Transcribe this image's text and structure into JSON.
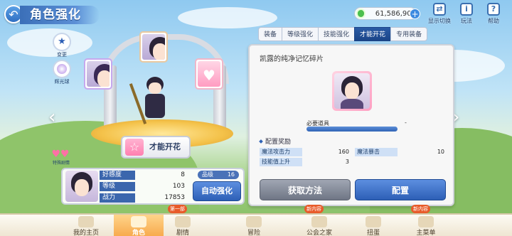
{
  "header": {
    "title": "角色强化",
    "money": "61,586,904",
    "icons": [
      {
        "icon": "display-switch-icon",
        "label": "显示切换"
      },
      {
        "icon": "howto-icon",
        "label": "玩法"
      },
      {
        "icon": "help-icon",
        "label": "帮助"
      }
    ]
  },
  "tabs": [
    {
      "label": "装备",
      "active": false
    },
    {
      "label": "等级强化",
      "active": false
    },
    {
      "label": "技能强化",
      "active": false
    },
    {
      "label": "才能开花",
      "active": true
    },
    {
      "label": "专用装备",
      "active": false
    }
  ],
  "panel": {
    "item_name": "凯露的纯净记忆碎片",
    "need_label": "必要道具",
    "need_count": "-",
    "need_progress": 1.0,
    "reward_title": "配置奖励",
    "stats": [
      {
        "name": "魔法攻击力",
        "value": "160"
      },
      {
        "name": "魔法暴击",
        "value": "10"
      },
      {
        "name": "技能值上升",
        "value": "3"
      }
    ],
    "obtain_label": "获取方法",
    "configure_label": "配置"
  },
  "side": {
    "change_label": "变更",
    "glow_label": "辉光球",
    "mini_label": "特殊剧情"
  },
  "bloom_label": "才能开花",
  "card": {
    "rows": [
      {
        "name": "好感度",
        "value": "8"
      },
      {
        "name": "等级",
        "value": "103"
      },
      {
        "name": "战力",
        "value": "17853"
      }
    ],
    "rank_label": "品级",
    "rank_value": "16",
    "auto_label": "自动强化"
  },
  "nav": [
    {
      "label": "我的主页",
      "badge": ""
    },
    {
      "label": "角色",
      "badge": "",
      "active": true
    },
    {
      "label": "剧情",
      "badge": "第一部"
    },
    {
      "label": "冒险",
      "badge": ""
    },
    {
      "label": "公会之家",
      "badge": "新内容"
    },
    {
      "label": "扭蛋",
      "badge": ""
    },
    {
      "label": "主菜单",
      "badge": "新内容"
    }
  ]
}
